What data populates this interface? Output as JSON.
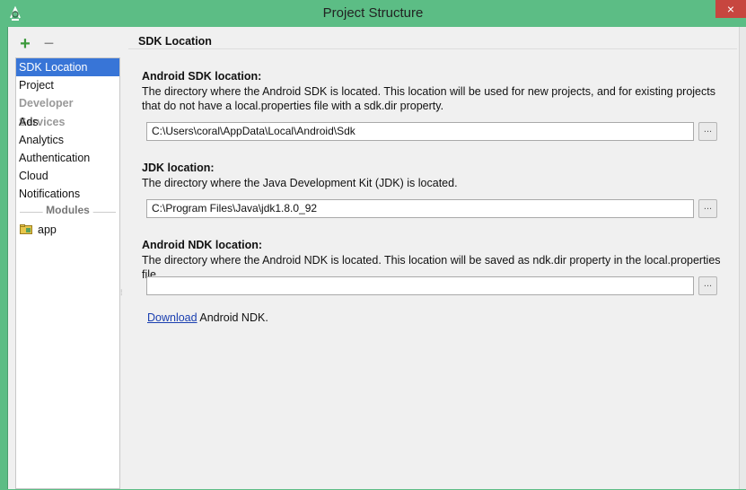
{
  "window": {
    "title": "Project Structure",
    "close_label": "×"
  },
  "toolbar": {
    "add_label": "+",
    "remove_label": "−"
  },
  "sidebar": {
    "items": [
      {
        "label": "SDK Location",
        "selected": true
      },
      {
        "label": "Project"
      }
    ],
    "group_label": "Developer Services",
    "services": [
      "Ads",
      "Analytics",
      "Authentication",
      "Cloud",
      "Notifications"
    ],
    "modules_label": "Modules",
    "modules": [
      "app"
    ]
  },
  "content": {
    "section_title": "SDK Location",
    "android_sdk": {
      "label": "Android SDK location:",
      "description": "The directory where the Android SDK is located. This location will be used for new projects, and for existing projects that do not have a local.properties file with a sdk.dir property.",
      "value": "C:\\Users\\coral\\AppData\\Local\\Android\\Sdk"
    },
    "jdk": {
      "label": "JDK location:",
      "description": "The directory where the Java Development Kit (JDK) is located.",
      "value": "C:\\Program Files\\Java\\jdk1.8.0_92"
    },
    "ndk": {
      "label": "Android NDK location:",
      "description": "The directory where the Android NDK is located. This location will be saved as ndk.dir property in the local.properties file.",
      "value": "",
      "download_link": "Download",
      "download_suffix": " Android NDK."
    },
    "browse_label": "..."
  },
  "colors": {
    "title_bar": "#5cbd85",
    "selection": "#3875d7",
    "link": "#1a3fb0",
    "close": "#c7463f"
  }
}
